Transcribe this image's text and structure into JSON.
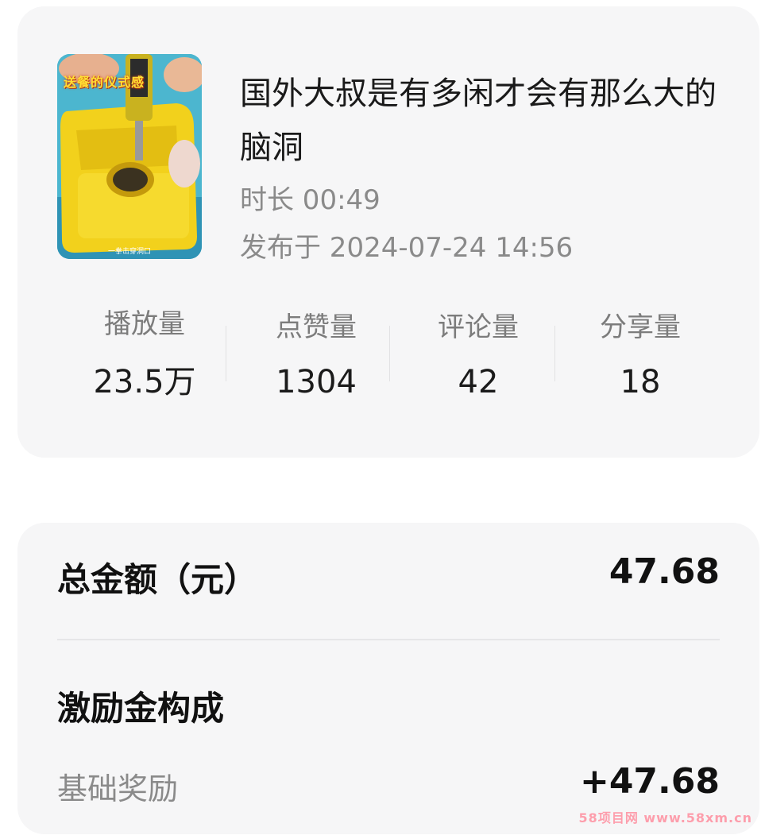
{
  "video": {
    "thumbnail_overlay": "送餐的仪式感",
    "thumbnail_caption": "一拳击穿洞口",
    "title": "国外大叔是有多闲才会有那么大的脑洞",
    "duration": "时长 00:49",
    "published": "发布于 2024-07-24 14:56"
  },
  "stats": [
    {
      "label": "播放量",
      "value": "23.5万"
    },
    {
      "label": "点赞量",
      "value": "1304"
    },
    {
      "label": "评论量",
      "value": "42"
    },
    {
      "label": "分享量",
      "value": "18"
    }
  ],
  "income": {
    "total_label": "总金额（元）",
    "total_value": "47.68",
    "breakdown_title": "激励金构成",
    "base_label": "基础奖励",
    "base_value": "+47.68"
  },
  "watermark": "58项目网 www.58xm.cn",
  "colors": {
    "card_bg": "#f6f6f7",
    "secondary_text": "#8a8a8a",
    "thumbnail_yellow": "#f2d11c"
  }
}
